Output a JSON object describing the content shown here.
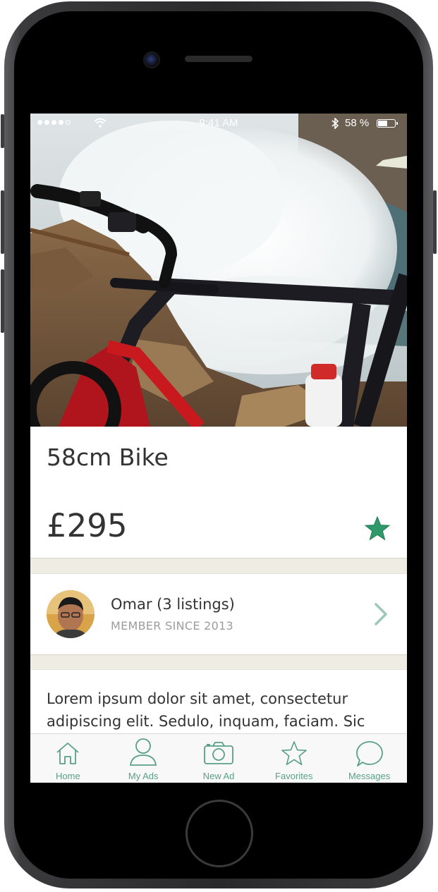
{
  "status_bar": {
    "time": "9:41 AM",
    "battery_percent": "58 %",
    "battery_level": 0.58
  },
  "listing": {
    "title": "58cm Bike",
    "price": "£295",
    "favorited": true,
    "accent_color": "#2e9a6c"
  },
  "seller": {
    "name": "Omar (3 listings)",
    "member_since": "MEMBER SINCE 2013"
  },
  "description": "Lorem ipsum dolor sit amet, consectetur adipiscing elit. Sedulo, inquam, faciam. Sic",
  "tabbar": {
    "tint_color": "#58a088",
    "tabs": [
      {
        "label": "Home",
        "icon": "home-icon"
      },
      {
        "label": "My Ads",
        "icon": "person-icon"
      },
      {
        "label": "New Ad",
        "icon": "camera-icon"
      },
      {
        "label": "Favorites",
        "icon": "star-icon"
      },
      {
        "label": "Messages",
        "icon": "chat-bubble-icon"
      }
    ]
  }
}
